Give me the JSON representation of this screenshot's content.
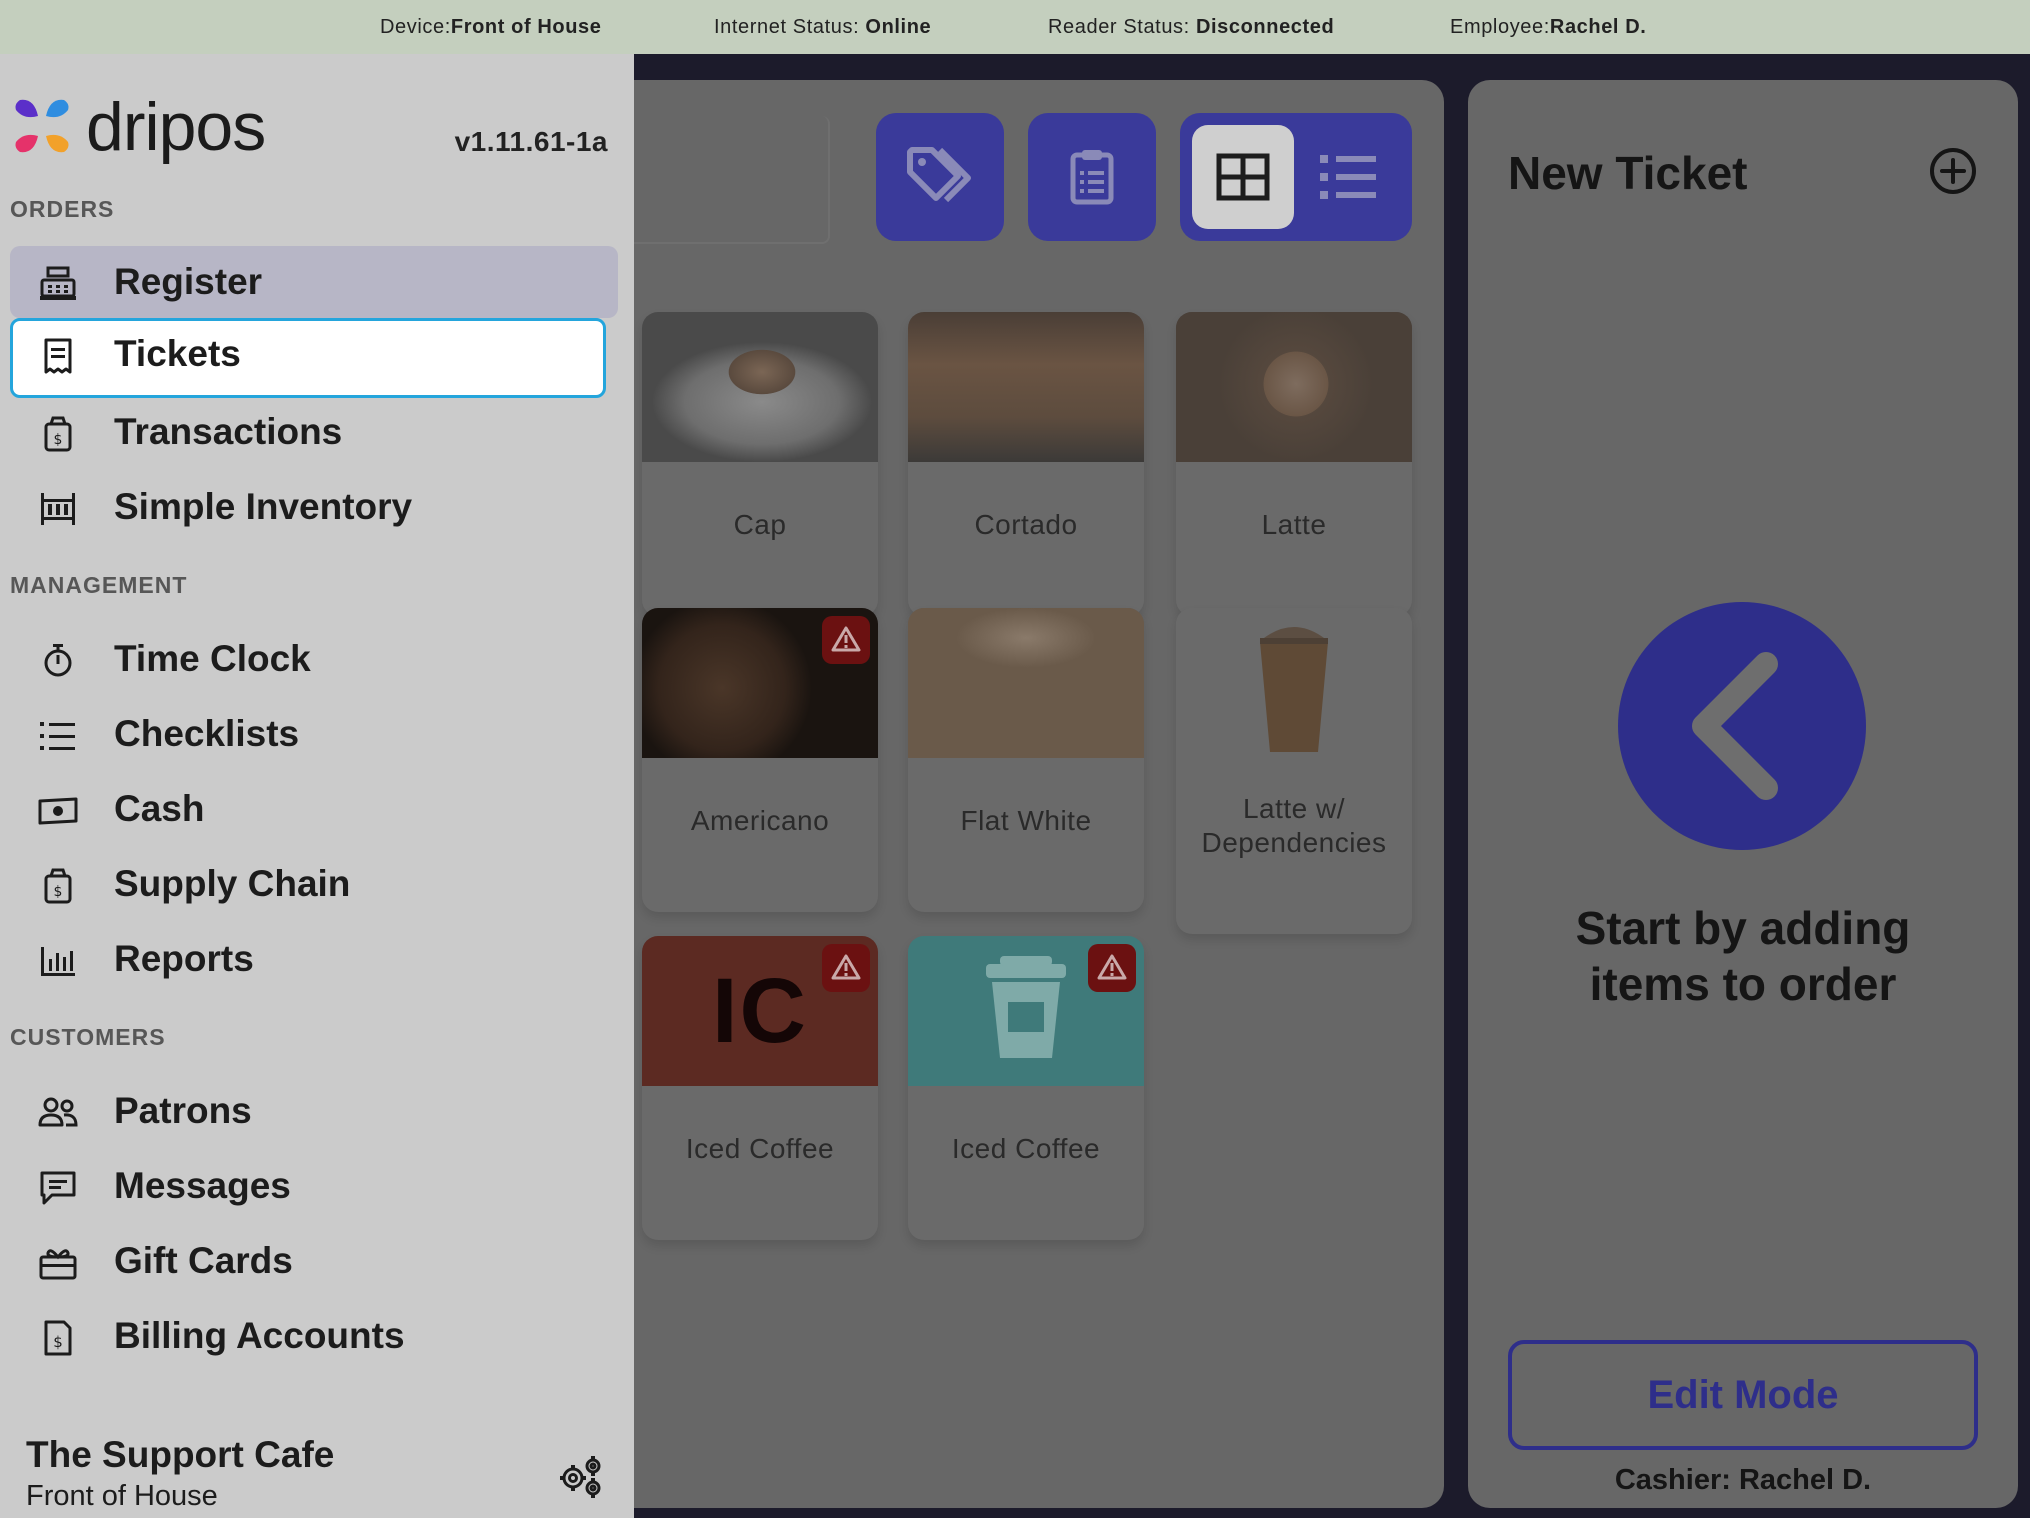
{
  "statusbar": {
    "device_label": "Device:",
    "device_value": "Front of House",
    "internet_label": "Internet Status: ",
    "internet_value": "Online",
    "reader_label": "Reader Status: ",
    "reader_value": "Disconnected",
    "employee_label": "Employee:",
    "employee_value": "Rachel D."
  },
  "sidebar": {
    "brand": "dripos",
    "version": "v1.11.61-1a",
    "sections": {
      "orders": "ORDERS",
      "management": "MANAGEMENT",
      "customers": "CUSTOMERS"
    },
    "items": {
      "register": "Register",
      "tickets": "Tickets",
      "transactions": "Transactions",
      "simple_inventory": "Simple Inventory",
      "time_clock": "Time Clock",
      "checklists": "Checklists",
      "cash": "Cash",
      "supply_chain": "Supply Chain",
      "reports": "Reports",
      "patrons": "Patrons",
      "messages": "Messages",
      "gift_cards": "Gift Cards",
      "billing_accounts": "Billing Accounts"
    },
    "footer": {
      "cafe_name": "The Support Cafe",
      "device": "Front of House"
    }
  },
  "products": {
    "items": [
      {
        "name": "Cap"
      },
      {
        "name": "Cortado"
      },
      {
        "name": "Latte"
      },
      {
        "name": "Americano",
        "warning": true
      },
      {
        "name": "Flat White"
      },
      {
        "name": "Latte w/ Dependencies"
      },
      {
        "name": "Iced Coffee",
        "initials": "IC",
        "warning": true
      },
      {
        "name": "Iced Coffee",
        "warning": true
      }
    ]
  },
  "ticket": {
    "title": "New Ticket",
    "empty_line1": "Start by adding",
    "empty_line2": "items to order",
    "edit_mode": "Edit Mode",
    "cashier": "Cashier: Rachel D."
  },
  "colors": {
    "accent": "#3a3a9a",
    "sidebar_bg": "#cbcbcb",
    "status_bar_bg": "#c4cfbe",
    "focus_ring": "#24a5dc",
    "warning": "#6b1111"
  }
}
